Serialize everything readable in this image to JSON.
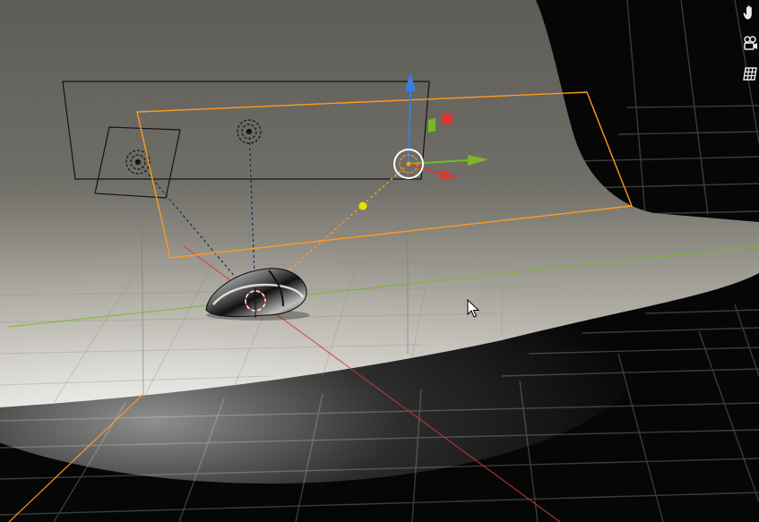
{
  "viewport": {
    "background_color": "#060606",
    "floor_grid_color": "#3a3a3a",
    "backdrop_color": "#6e6d66",
    "selection_color": "#ff9a1f",
    "axis_x_color": "#d43a3a",
    "axis_y_color": "#7ab828",
    "axis_z_color": "#3a7ce0",
    "cursor_target_color": "#e8e000"
  },
  "navigation": {
    "tools": [
      {
        "id": "hand",
        "icon": "hand-icon",
        "tooltip": ""
      },
      {
        "id": "camera",
        "icon": "camera-icon",
        "tooltip": ""
      },
      {
        "id": "grid",
        "icon": "grid-icon",
        "tooltip": ""
      }
    ]
  },
  "objects": [
    {
      "type": "area-light",
      "selected": false,
      "icon": "area-light-icon"
    },
    {
      "type": "area-light",
      "selected": false,
      "icon": "area-light-icon"
    },
    {
      "type": "area-light",
      "selected": true,
      "icon": "area-light-icon"
    },
    {
      "type": "mesh",
      "name": "",
      "icon": "mouse-mesh-icon"
    }
  ]
}
